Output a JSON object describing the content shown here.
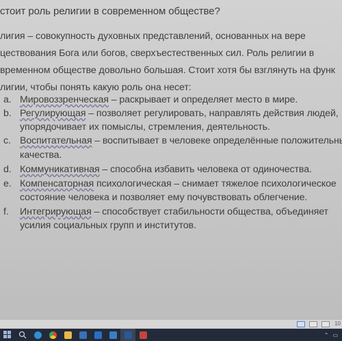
{
  "document": {
    "title": "стоит роль религии в современном обществе?",
    "intro_lines": [
      "лигия – совокупность духовных представлений, основанных на вере",
      "цествования Бога или богов, сверхъестественных сил. Роль религии в",
      "временном обществе довольно большая. Стоит хотя бы взглянуть на функ",
      "лигии, чтобы понять какую роль она несет:"
    ],
    "items": [
      {
        "marker": "a.",
        "term": "Мировоззренческая",
        "rest": " – раскрывает и определяет место в мире.",
        "cont": ""
      },
      {
        "marker": "b.",
        "term": "Регулирующая",
        "rest": " – позволяет регулировать, направлять действия людей,",
        "cont": "упорядочивает их помыслы, стремления, деятельность."
      },
      {
        "marker": "c.",
        "term": "Воспитательная",
        "rest": " – воспитывает в человеке определённые положительны",
        "cont": "качества."
      },
      {
        "marker": "d.",
        "term": "Коммуникативная",
        "rest": " – способна избавить человека от одиночества.",
        "cont": ""
      },
      {
        "marker": "e.",
        "term": "Компенсаторная",
        "rest": " психологическая – снимает тяжелое психологическое",
        "cont": "состояние человека и позволяет ему почувствовать облегчение."
      },
      {
        "marker": "f.",
        "term": "Интегрирующая",
        "rest": " – способствует стабильности общества, объединяет",
        "cont": "усилия социальных групп и институтов."
      }
    ]
  },
  "statusbar": {
    "zoom_label": "10"
  },
  "colors": {
    "text": "#3e3e3e",
    "page": "#cfcfcf",
    "taskbar": "#232b3a"
  }
}
